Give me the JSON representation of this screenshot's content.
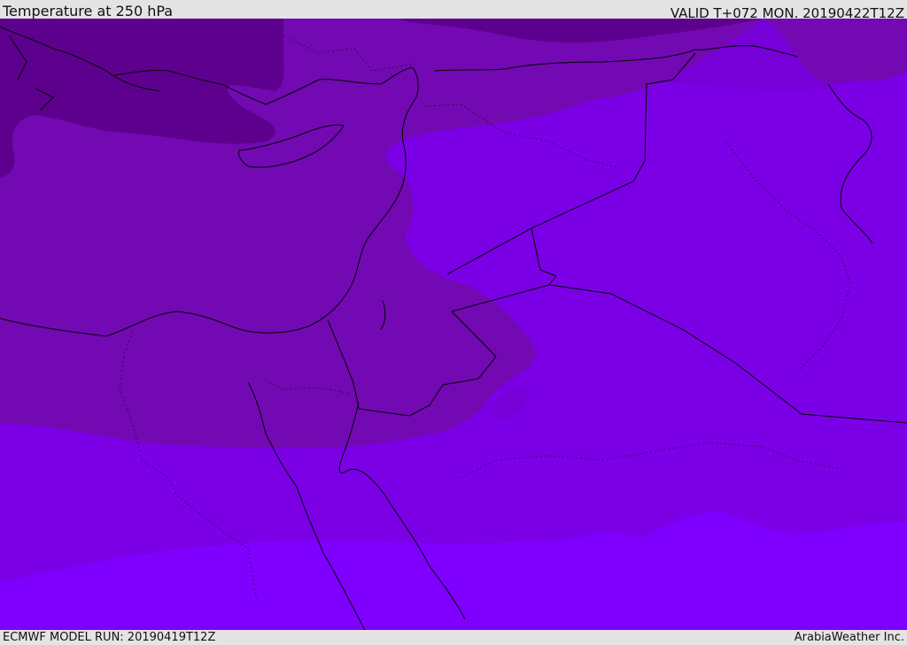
{
  "header": {
    "title": "Temperature at 250 hPa",
    "valid": "VALID T+072 MON. 20190422T12Z"
  },
  "footer": {
    "model_run": "ECMWF MODEL RUN: 20190419T12Z",
    "credit": "ArabiaWeather Inc."
  },
  "map": {
    "field": "temperature",
    "level_hpa": 250,
    "colors": {
      "coldest": "#5e008e",
      "cold": "#7209b2",
      "mid": "#7700d8",
      "warm": "#7b00e6",
      "warmest": "#7f00ff"
    }
  }
}
